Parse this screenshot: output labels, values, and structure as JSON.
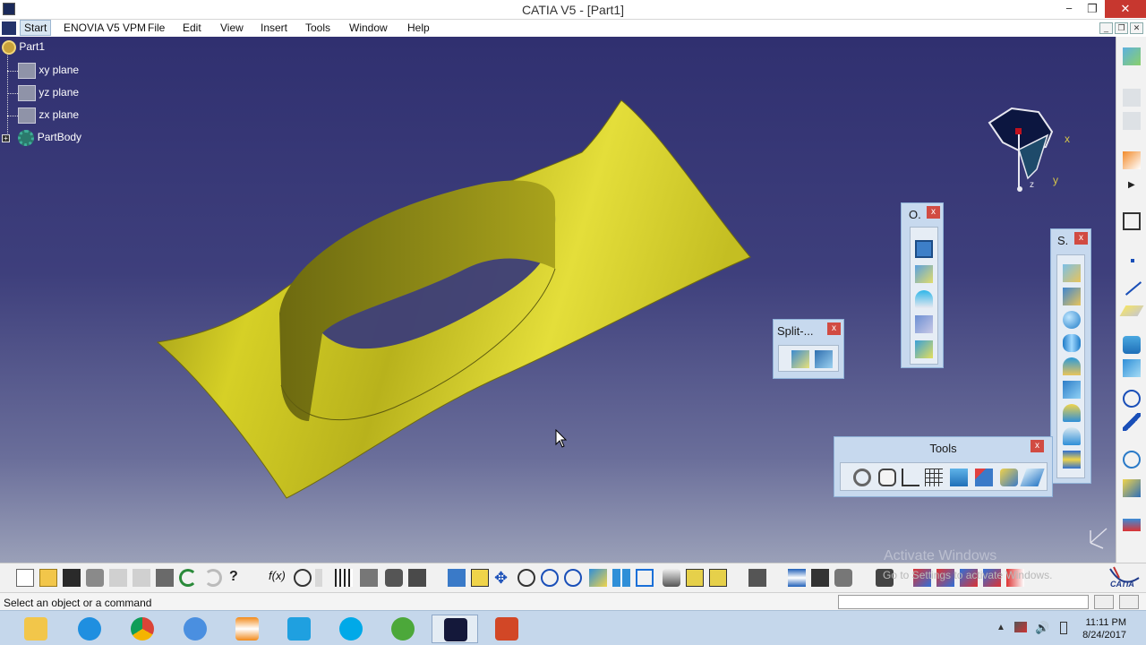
{
  "window": {
    "title": "CATIA V5 - [Part1]",
    "minimize": "−",
    "maximize": "❐",
    "close": "✕"
  },
  "menu": {
    "start": "Start",
    "items": [
      "ENOVIA V5 VPM",
      "File",
      "Edit",
      "View",
      "Insert",
      "Tools",
      "Window",
      "Help"
    ]
  },
  "tree": {
    "root": "Part1",
    "items": [
      "xy plane",
      "yz plane",
      "zx plane",
      "PartBody"
    ]
  },
  "compass": {
    "x_label": "x",
    "y_label": "y",
    "z_label": "z"
  },
  "panels": {
    "split": {
      "title": "Split-..."
    },
    "operations": {
      "title": "O."
    },
    "surfaces": {
      "title": "S."
    },
    "tools": {
      "title": "Tools"
    }
  },
  "watermark": {
    "line1": "Activate Windows",
    "line2": "Go to Settings to activate Windows."
  },
  "status": {
    "text": "Select an object or a command"
  },
  "clock": {
    "time": "11:11 PM",
    "date": "8/24/2017"
  },
  "brand": {
    "logo": "CATIA"
  },
  "colors": {
    "part": "#d9d42a",
    "background_top": "#303070",
    "background_bottom": "#9aa0b8",
    "close_red": "#d14b42"
  }
}
